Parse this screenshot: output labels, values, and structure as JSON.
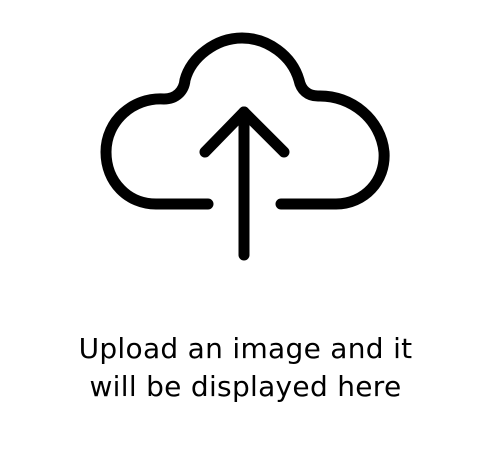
{
  "upload_panel": {
    "icon": "cloud-upload-icon",
    "message_line1": "Upload an image and it",
    "message_line2": "will be displayed here"
  },
  "colors": {
    "background": "#ffffff",
    "foreground": "#000000"
  }
}
